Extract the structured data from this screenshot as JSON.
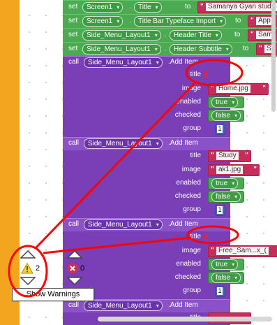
{
  "set_blocks": [
    {
      "kw_set": "set",
      "component": "Screen1",
      "prop": "Title",
      "kw_to": "to",
      "value": "Samanya Gyan study &"
    },
    {
      "kw_set": "set",
      "component": "Screen1",
      "prop": "Title Bar Typeface Import",
      "kw_to": "to",
      "value": "App"
    },
    {
      "kw_set": "set",
      "component": "Side_Menu_Layout1",
      "prop": "Header Title",
      "kw_to": "to",
      "value": "Sam"
    },
    {
      "kw_set": "set",
      "component": "Side_Menu_Layout1",
      "prop": "Header Subtitle",
      "kw_to": "to",
      "value": "S"
    }
  ],
  "call_blocks": [
    {
      "kw_call": "call",
      "component": "Side_Menu_Layout1",
      "method": ".Add Item",
      "labels": {
        "title": "title",
        "image": "image",
        "enabled": "enabled",
        "checked": "checked",
        "group": "group"
      },
      "title": "",
      "image": "Home.jpg",
      "enabled": "true",
      "checked": "false",
      "group": "1"
    },
    {
      "kw_call": "call",
      "component": "Side_Menu_Layout1",
      "method": ".Add Item",
      "labels": {
        "title": "title",
        "image": "image",
        "enabled": "enabled",
        "checked": "checked",
        "group": "group"
      },
      "title": "Study",
      "image": "ak1.jpg",
      "enabled": "true",
      "checked": "false",
      "group": "1"
    },
    {
      "kw_call": "call",
      "component": "Side_Menu_Layout1",
      "method": ".Add Item",
      "labels": {
        "title": "title",
        "image": "image",
        "enabled": "enabled",
        "checked": "checked",
        "group": "group"
      },
      "title": "",
      "image": "Free_Sam...x_(",
      "enabled": "true",
      "checked": "false",
      "group": "1"
    },
    {
      "kw_call": "call",
      "component": "Side_Menu_Layout1",
      "method": ".Add Item",
      "labels": {
        "title": "title"
      }
    }
  ],
  "warnings": {
    "count": "2",
    "errors": "0",
    "show_warnings_label": "Show Warnings"
  },
  "colors": {
    "event_orange": "#f4a520",
    "set_green": "#4caa52",
    "call_purple": "#7a3fb7",
    "text_red": "#c62d5a",
    "number_blue": "#4a66b3",
    "annotation_red": "#ff0000"
  }
}
